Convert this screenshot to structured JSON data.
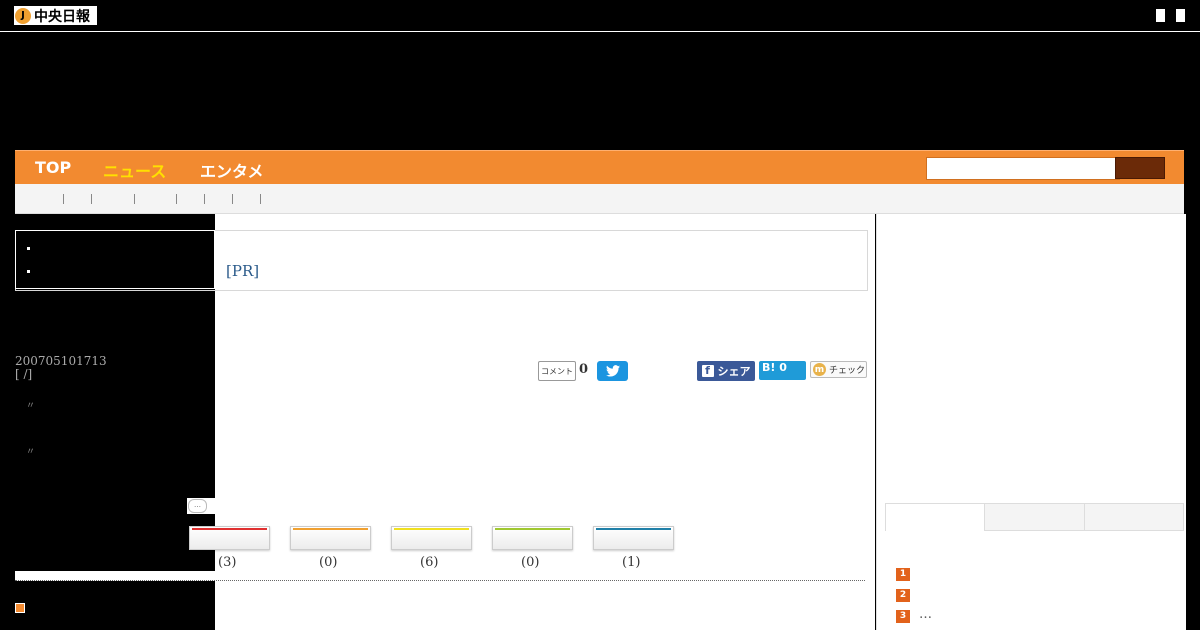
{
  "header": {
    "logo_mark": "J",
    "logo_text": "中央日報"
  },
  "nav": {
    "items": [
      {
        "label": "TOP",
        "active": false
      },
      {
        "label": "ニュース",
        "active": true
      },
      {
        "label": "エンタメ",
        "active": false
      }
    ],
    "search_placeholder": ""
  },
  "article": {
    "pr_label": "[PR]",
    "date_line": "200705101713",
    "source_line": "[ /]",
    "quote_1": "〃",
    "quote_2": "〃"
  },
  "share": {
    "comment_label": "コメント",
    "comment_count": "0",
    "facebook_label": "シェア",
    "hatena_label": "B! 0",
    "mixi_label": "チェック"
  },
  "reactions": {
    "bubble": "…",
    "items": [
      {
        "count": "(3)",
        "color": "#e03030"
      },
      {
        "count": "(0)",
        "color": "#f0a030"
      },
      {
        "count": "(6)",
        "color": "#f0e020"
      },
      {
        "count": "(0)",
        "color": "#a0c830"
      },
      {
        "count": "(1)",
        "color": "#2080a8"
      }
    ]
  },
  "ranking": {
    "items": [
      {
        "rank": "1",
        "text": ""
      },
      {
        "rank": "2",
        "text": ""
      },
      {
        "rank": "3",
        "text": "…"
      }
    ]
  },
  "colors": {
    "nav_orange": "#f28a30",
    "nav_active": "#ffe000",
    "rank_orange": "#e2621b"
  }
}
